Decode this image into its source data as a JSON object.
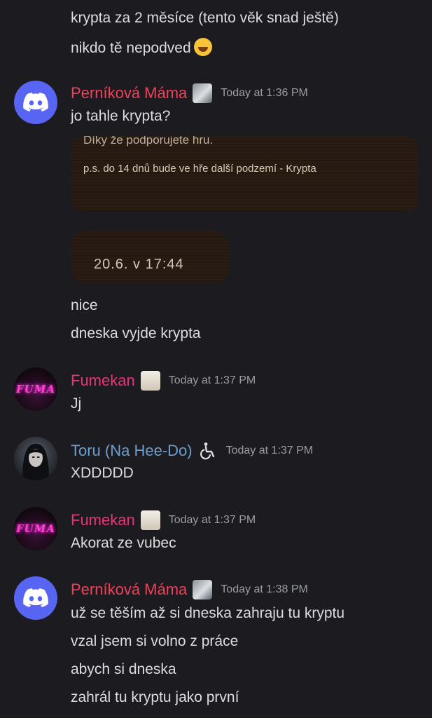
{
  "messages": {
    "top": {
      "line1": "krypta za 2 měsíce (tento věk snad ještě)",
      "line2": "nikdo tě nepodved"
    },
    "msg1": {
      "author": "Perníková Máma",
      "timestamp": "Today at 1:36 PM",
      "text": "jo tahle krypta?",
      "embed1_line1": "Díky že podporujete hru.",
      "embed1_line2": "p.s. do 14 dnů bude ve hře další podzemí - Krypta",
      "embed2_text": "20.6. v 17:44",
      "after1": "nice",
      "after2": "dneska vyjde krypta"
    },
    "msg2": {
      "author": "Fumekan",
      "avatar_text": "FUMA",
      "timestamp": "Today at 1:37 PM",
      "text": "Jj"
    },
    "msg3": {
      "author": "Toru (Na Hee-Do)",
      "timestamp": "Today at 1:37 PM",
      "text": "XDDDDD"
    },
    "msg4": {
      "author": "Fumekan",
      "avatar_text": "FUMA",
      "timestamp": "Today at 1:37 PM",
      "text": "Akorat ze vubec"
    },
    "msg5": {
      "author": "Perníková Máma",
      "timestamp": "Today at 1:38 PM",
      "lines": [
        "už se těším až si dneska zahraju tu kryptu",
        "vzal jsem si volno z práce",
        "abych si dneska",
        "zahrál tu kryptu jako první"
      ]
    }
  },
  "colors": {
    "background": "#1c1c20",
    "pernikova": "#f23f5a",
    "fumekan": "#e9347c",
    "toru": "#6c9fd0",
    "discord_blue": "#5865f2"
  },
  "icons": {
    "discord": "discord-logo-icon",
    "smile": "grinning-face-emoji",
    "cat": "cat-badge-icon",
    "wheelchair": "wheelchair-icon"
  }
}
